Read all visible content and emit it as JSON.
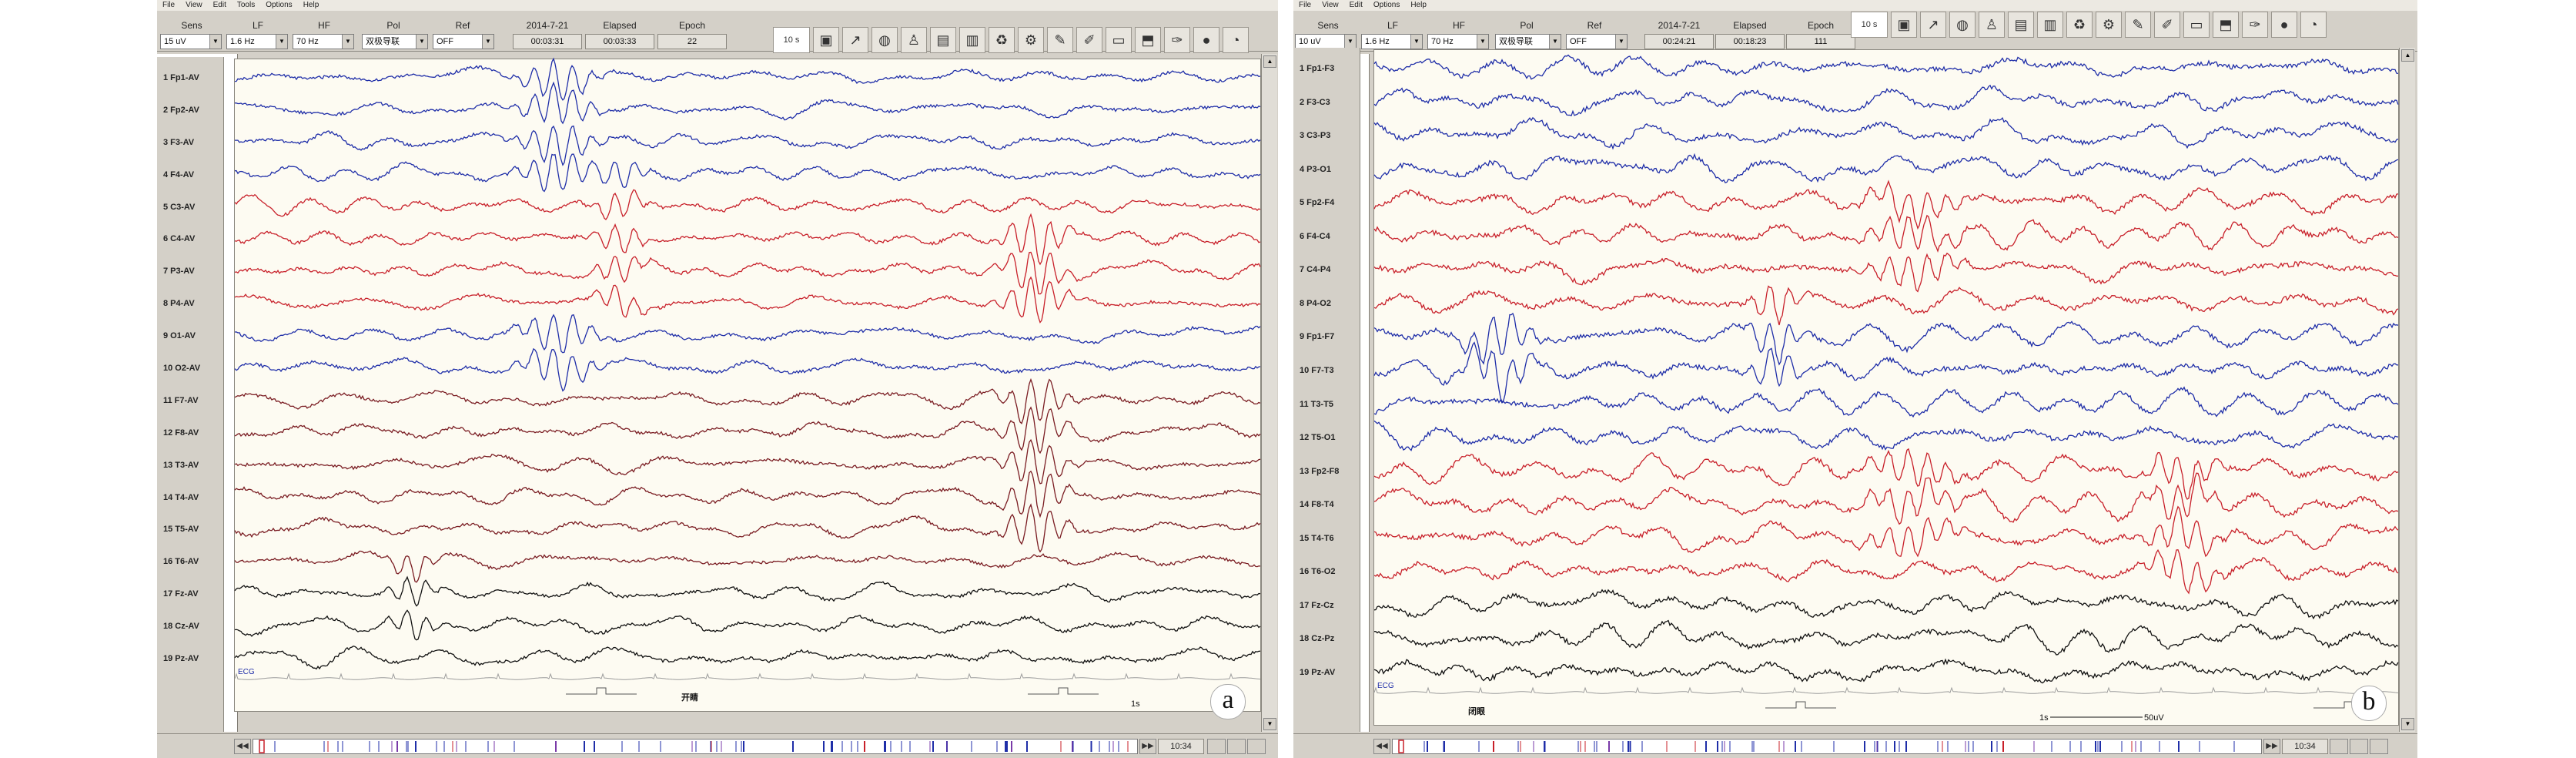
{
  "panels": [
    {
      "id": "a",
      "menu": [
        "File",
        "View",
        "Edit",
        "Tools",
        "Options",
        "Help"
      ],
      "controls": {
        "sens_label": "Sens",
        "lf_label": "LF",
        "hf_label": "HF",
        "pol_label": "Pol",
        "ref_label": "Ref",
        "sens_value": "15 uV",
        "lf_value": "1.6 Hz",
        "hf_value": "70 Hz",
        "pol_value": "双极导联",
        "ref_value": "OFF",
        "date": "2014-7-21",
        "elapsed_label": "Elapsed",
        "elapsed_value": "00:03:33",
        "epoch_label": "Epoch",
        "epoch_value": "22",
        "time_cursor": "00:03:31",
        "speed_value": "10 s"
      },
      "channels": [
        {
          "label": "1 Fp1-AV",
          "color": "#1f2ea8"
        },
        {
          "label": "2 Fp2-AV",
          "color": "#1f2ea8"
        },
        {
          "label": "3 F3-AV",
          "color": "#1f2ea8"
        },
        {
          "label": "4 F4-AV",
          "color": "#1f2ea8"
        },
        {
          "label": "5 C3-AV",
          "color": "#c8202a"
        },
        {
          "label": "6 C4-AV",
          "color": "#c8202a"
        },
        {
          "label": "7 P3-AV",
          "color": "#c8202a"
        },
        {
          "label": "8 P4-AV",
          "color": "#c8202a"
        },
        {
          "label": "9 O1-AV",
          "color": "#1f2ea8"
        },
        {
          "label": "10 O2-AV",
          "color": "#1f2ea8"
        },
        {
          "label": "11 F7-AV",
          "color": "#7a1c22"
        },
        {
          "label": "12 F8-AV",
          "color": "#7a1c22"
        },
        {
          "label": "13 T3-AV",
          "color": "#7a1c22"
        },
        {
          "label": "14 T4-AV",
          "color": "#7a1c22"
        },
        {
          "label": "15 T5-AV",
          "color": "#7a1c22"
        },
        {
          "label": "16 T6-AV",
          "color": "#7a1c22"
        },
        {
          "label": "17 Fz-AV",
          "color": "#111111"
        },
        {
          "label": "18 Cz-AV",
          "color": "#111111"
        },
        {
          "label": "19 Pz-AV",
          "color": "#111111"
        }
      ],
      "ecg_label": "ECG",
      "event_label": "开睛",
      "scale_label": "1s",
      "bottom_time": "10:34",
      "letter": "a"
    },
    {
      "id": "b",
      "menu": [
        "File",
        "View",
        "Edit",
        "Options",
        "Help"
      ],
      "controls": {
        "sens_label": "Sens",
        "lf_label": "LF",
        "hf_label": "HF",
        "pol_label": "Pol",
        "ref_label": "Ref",
        "sens_value": "10 uV",
        "lf_value": "1.6 Hz",
        "hf_value": "70 Hz",
        "pol_value": "双极导联",
        "ref_value": "OFF",
        "date": "2014-7-21",
        "elapsed_label": "Elapsed",
        "elapsed_value": "00:18:23",
        "epoch_label": "Epoch",
        "epoch_value": "111",
        "time_cursor": "00:24:21",
        "speed_value": "10 s"
      },
      "channels": [
        {
          "label": "1 Fp1-F3",
          "color": "#1f2ea8"
        },
        {
          "label": "2 F3-C3",
          "color": "#1f2ea8"
        },
        {
          "label": "3 C3-P3",
          "color": "#1f2ea8"
        },
        {
          "label": "4 P3-O1",
          "color": "#1f2ea8"
        },
        {
          "label": "5 Fp2-F4",
          "color": "#c8202a"
        },
        {
          "label": "6 F4-C4",
          "color": "#c8202a"
        },
        {
          "label": "7 C4-P4",
          "color": "#c8202a"
        },
        {
          "label": "8 P4-O2",
          "color": "#c8202a"
        },
        {
          "label": "9 Fp1-F7",
          "color": "#1f2ea8"
        },
        {
          "label": "10 F7-T3",
          "color": "#1f2ea8"
        },
        {
          "label": "11 T3-T5",
          "color": "#1f2ea8"
        },
        {
          "label": "12 T5-O1",
          "color": "#1f2ea8"
        },
        {
          "label": "13 Fp2-F8",
          "color": "#c8202a"
        },
        {
          "label": "14 F8-T4",
          "color": "#c8202a"
        },
        {
          "label": "15 T4-T6",
          "color": "#c8202a"
        },
        {
          "label": "16 T6-O2",
          "color": "#c8202a"
        },
        {
          "label": "17 Fz-Cz",
          "color": "#111111"
        },
        {
          "label": "18 Cz-Pz",
          "color": "#111111"
        },
        {
          "label": "19 Pz-AV",
          "color": "#111111"
        }
      ],
      "ecg_label": "ECG",
      "event_label": "闭眼",
      "scale_label": "1s",
      "scale_amp": "50uV",
      "bottom_time": "10:34",
      "letter": "b"
    }
  ],
  "icons": [
    "save-icon",
    "chart-icon",
    "globe-icon",
    "person-icon",
    "print-icon",
    "book-icon",
    "recycle-icon",
    "settings-icon",
    "marker-icon",
    "edit-icon",
    "ruler-icon",
    "folder-icon",
    "brush-icon",
    "circle-icon",
    "spectrum-icon"
  ]
}
